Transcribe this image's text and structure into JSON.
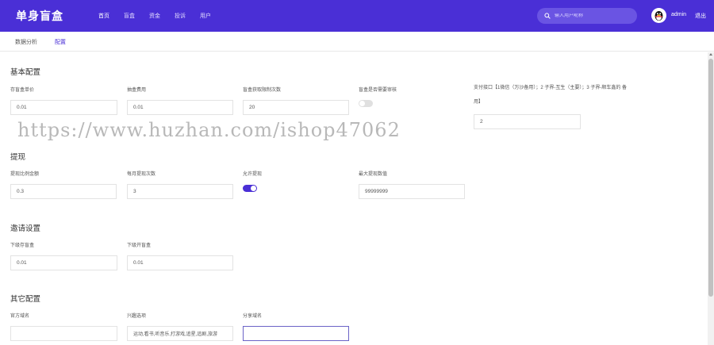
{
  "header": {
    "brand": "单身盲盒",
    "nav": [
      "首页",
      "盲盒",
      "资金",
      "投诉",
      "用户"
    ],
    "search_placeholder": "输入用户昵称",
    "user": "admin",
    "logout": "退出"
  },
  "tabs": [
    "数据分析",
    "配置"
  ],
  "sections": {
    "basic": {
      "title": "基本配置",
      "fields": [
        {
          "label": "存盲盒单价",
          "value": "0.01"
        },
        {
          "label": "抽盒费用",
          "value": "0.01"
        },
        {
          "label": "盲盒获取限制次数",
          "value": "20"
        },
        {
          "label": "盲盒是否需要审核"
        },
        {
          "label": "支付接口【1微信（万沙备用）；2 子界-互生（主要）；3 子界-顺车鑫的 备用】",
          "value": "2"
        }
      ]
    },
    "withdraw": {
      "title": "提现",
      "fields": [
        {
          "label": "提现比例金额",
          "value": "0.3"
        },
        {
          "label": "每月提现次数",
          "value": "3"
        },
        {
          "label": "允许提现"
        },
        {
          "label": "最大提现数值",
          "value": "99999999"
        }
      ]
    },
    "invite": {
      "title": "邀请设置",
      "fields": [
        {
          "label": "下级存盲盒",
          "value": "0.01"
        },
        {
          "label": "下级开盲盒",
          "value": "0.01"
        }
      ]
    },
    "other": {
      "title": "其它配置",
      "fields": [
        {
          "label": "官方域名",
          "value": ""
        },
        {
          "label": "兴趣选项",
          "value": "运动,看书,听音乐,打游戏,追星,追剧,旅游"
        },
        {
          "label": "分享域名",
          "value": ""
        }
      ]
    }
  },
  "watermark": "https://www.huzhan.com/ishop47062",
  "colors": {
    "accent": "#4a2fd6",
    "toggle_off": "#e0e0e0"
  }
}
